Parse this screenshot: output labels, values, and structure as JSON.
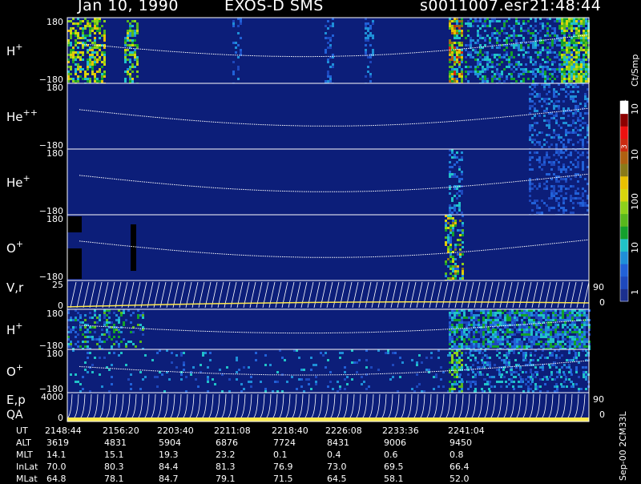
{
  "header": {
    "date": "Jan 10, 1990",
    "instrument": "EXOS-D SMS",
    "file": "s0011007.esr",
    "time": "21:48:44"
  },
  "colorbar": {
    "unit_label": "Ct/Smp",
    "tick_labels": [
      "1",
      "10",
      "100",
      "10",
      "3",
      "10",
      "4"
    ],
    "colors": [
      "#1b2f8e",
      "#1d48bd",
      "#2161d8",
      "#1e8fd8",
      "#20c2c8",
      "#13a02c",
      "#58b81c",
      "#8ed21a",
      "#d7d60c",
      "#e8c000",
      "#8a7a18",
      "#b06010",
      "#cc2a10",
      "#ee1010",
      "#8c0000",
      "#ffffff"
    ],
    "background": "#0c1e79"
  },
  "panels": [
    {
      "id": "H1",
      "label": "H",
      "sup": "+",
      "y_top": "180",
      "y_bottom": "−180"
    },
    {
      "id": "He2",
      "label": "He",
      "sup": "++",
      "y_top": "180",
      "y_bottom": "−180"
    },
    {
      "id": "He1",
      "label": "He",
      "sup": "+",
      "y_top": "180",
      "y_bottom": "−180"
    },
    {
      "id": "O1",
      "label": "O",
      "sup": "+",
      "y_top": "180",
      "y_bottom": "−180"
    },
    {
      "id": "V",
      "label": "V,r",
      "sup": "",
      "y_top": "25",
      "y_bottom": "0",
      "right_top": "90",
      "right_bottom": "0"
    },
    {
      "id": "H2",
      "label": "H",
      "sup": "+",
      "y_top": "180",
      "y_bottom": "−180"
    },
    {
      "id": "O2",
      "label": "O",
      "sup": "+",
      "y_top": "180",
      "y_bottom": "−180"
    },
    {
      "id": "E",
      "label": "E,p",
      "label2": "QA",
      "sup": "",
      "y_top": "4000",
      "y_bottom": "0",
      "right_top": "90",
      "right_bottom": "0"
    }
  ],
  "ephemeris": {
    "row_labels": [
      "UT",
      "ALT",
      "MLT",
      "InLat",
      "MLat"
    ],
    "columns": [
      {
        "UT": "2148:44",
        "ALT": "3619",
        "MLT": "14.1",
        "InLat": "70.0",
        "MLat": "64.8"
      },
      {
        "UT": "2156:20",
        "ALT": "4831",
        "MLT": "15.1",
        "InLat": "80.3",
        "MLat": "78.1"
      },
      {
        "UT": "2203:40",
        "ALT": "5904",
        "MLT": "19.3",
        "InLat": "84.4",
        "MLat": "84.7"
      },
      {
        "UT": "2211:08",
        "ALT": "6876",
        "MLT": "23.2",
        "InLat": "81.3",
        "MLat": "79.1"
      },
      {
        "UT": "2218:40",
        "ALT": "7724",
        "MLT": "0.1",
        "InLat": "76.9",
        "MLat": "71.5"
      },
      {
        "UT": "2226:08",
        "ALT": "8431",
        "MLT": "0.4",
        "InLat": "73.0",
        "MLat": "64.5"
      },
      {
        "UT": "2233:36",
        "ALT": "9006",
        "MLT": "0.6",
        "InLat": "69.5",
        "MLat": "58.1"
      },
      {
        "UT": "2241:04",
        "ALT": "9450",
        "MLT": "0.8",
        "InLat": "66.4",
        "MLat": "52.0"
      }
    ]
  },
  "footer": {
    "side_text": "Sep-00 2CM33L"
  },
  "chart_data": {
    "type": "heatmap",
    "title": "Jan 10, 1990   EXOS-D SMS",
    "x_tick_labels": [
      "2148:44",
      "2156:20",
      "2203:40",
      "2211:08",
      "2218:40",
      "2226:08",
      "2233:36",
      "2241:04"
    ],
    "colorbar_label": "Ct/Smp",
    "colorbar_ticks": [
      "1",
      "10",
      "100",
      "10",
      "3",
      "10",
      "4"
    ],
    "series": [
      {
        "name": "H",
        "ylim": [
          -180,
          180
        ]
      },
      {
        "name": "He",
        "ylim": [
          -180,
          180
        ]
      },
      {
        "name": "He",
        "ylim": [
          -180,
          180
        ]
      },
      {
        "name": "O",
        "ylim": [
          -180,
          180
        ]
      },
      {
        "name": "V,r",
        "ylim": [
          0,
          25
        ],
        "right_ylim": [
          0,
          90
        ]
      },
      {
        "name": "H",
        "ylim": [
          -180,
          180
        ]
      },
      {
        "name": "O",
        "ylim": [
          -180,
          180
        ]
      },
      {
        "name": "E,p",
        "ylim": [
          0,
          4000
        ],
        "right_ylim": [
          0,
          90
        ]
      }
    ],
    "grid": false,
    "legend": "right"
  }
}
